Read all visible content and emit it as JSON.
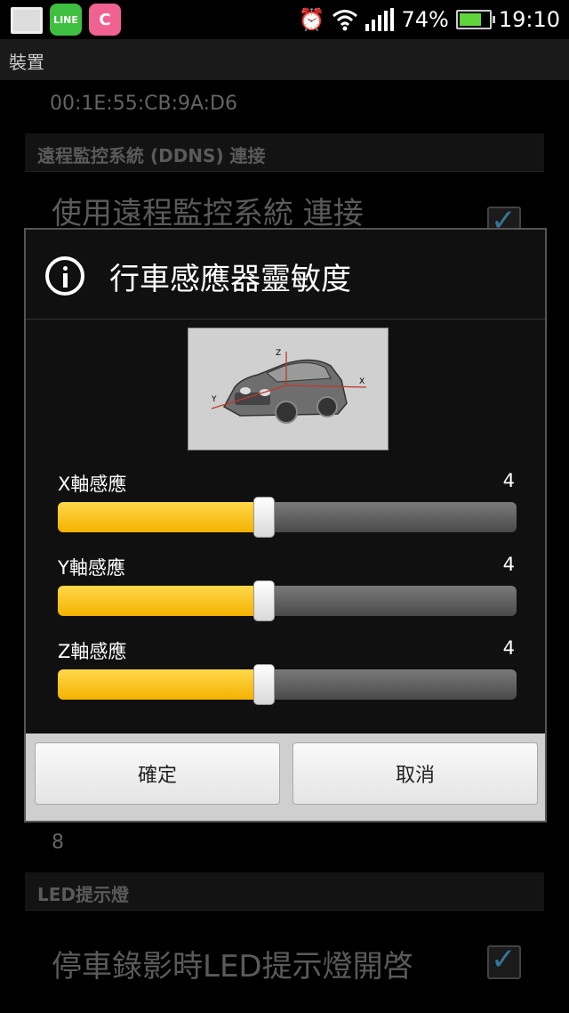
{
  "status_bar": {
    "line_label": "LINE",
    "c_label": "C",
    "battery": "74%",
    "time": "19:10"
  },
  "background": {
    "title": "裝置",
    "mac_address": "00:1E:55:CB:9A:D6",
    "section_ddns": "遠程監控系統 (DDNS) 連接",
    "ddns_item": "使用遠程監控系統 連接",
    "value_8": "8",
    "section_led": "LED提示燈",
    "led_item": "停車錄影時LED提示燈開啓"
  },
  "dialog": {
    "title": "行車感應器靈敏度",
    "axis_labels": {
      "x": "X",
      "y": "Y",
      "z": "Z"
    },
    "sliders": [
      {
        "label": "X軸感應",
        "value": "4",
        "level_fraction": 0.45
      },
      {
        "label": "Y軸感應",
        "value": "4",
        "level_fraction": 0.45
      },
      {
        "label": "Z軸感應",
        "value": "4",
        "level_fraction": 0.45
      }
    ],
    "ok_label": "確定",
    "cancel_label": "取消"
  },
  "colors": {
    "slider_fill": "#f4b200",
    "check_accent": "#4fb5e8"
  }
}
